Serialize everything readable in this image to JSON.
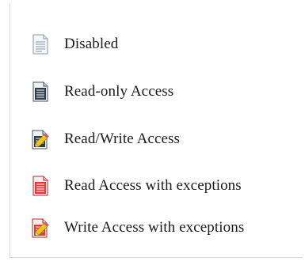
{
  "legend": {
    "items": [
      {
        "label": "Disabled",
        "icon": "document-disabled-icon"
      },
      {
        "label": "Read-only Access",
        "icon": "document-read-only-icon"
      },
      {
        "label": "Read/Write Access",
        "icon": "document-edit-icon"
      },
      {
        "label": "Read Access with exceptions",
        "icon": "document-read-exceptions-icon"
      },
      {
        "label": "Write Access with exceptions",
        "icon": "document-write-exceptions-icon"
      }
    ]
  },
  "colors": {
    "disabled_page": "#f4f7fa",
    "disabled_lines": "#9aa7b4",
    "dark_page": "#2e3b46",
    "red_page": "#e23a3a",
    "pencil_yellow": "#f0c419",
    "pencil_tip": "#d4518f",
    "text": "#1a1a1a"
  }
}
